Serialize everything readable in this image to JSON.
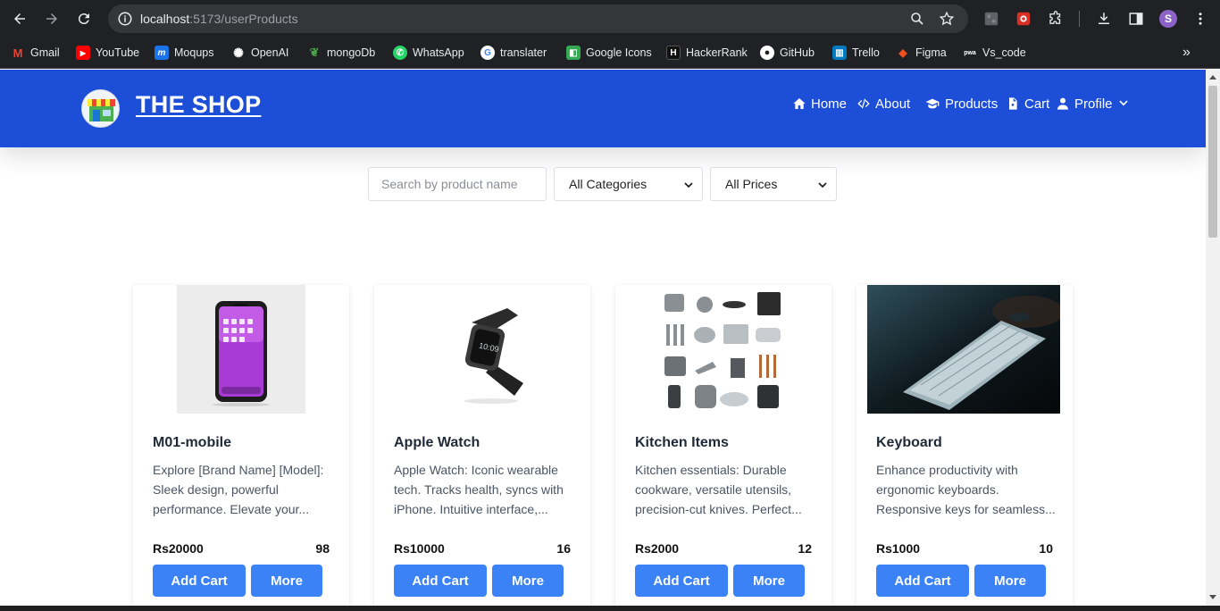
{
  "browser": {
    "url_host": "localhost",
    "url_path": ":5173/userProducts",
    "avatar_letter": "S",
    "bookmarks": [
      {
        "label": "Gmail",
        "icon": "gmail-icon",
        "color": "#ea4335",
        "glyph": "M"
      },
      {
        "label": "YouTube",
        "icon": "youtube-icon",
        "color": "#ff0000",
        "glyph": "▶"
      },
      {
        "label": "Moqups",
        "icon": "moqups-icon",
        "color": "#1a73e8",
        "glyph": "m"
      },
      {
        "label": "OpenAI",
        "icon": "openai-icon",
        "color": "#202124",
        "glyph": "✺"
      },
      {
        "label": "mongoDb",
        "icon": "mongodb-icon",
        "color": "#0b3d2e",
        "glyph": "❦"
      },
      {
        "label": "WhatsApp",
        "icon": "whatsapp-icon",
        "color": "#25d366",
        "glyph": "✆"
      },
      {
        "label": "translater",
        "icon": "google-icon",
        "color": "#ffffff",
        "glyph": "G"
      },
      {
        "label": "Google Icons",
        "icon": "google-icons-icon",
        "color": "#34a853",
        "glyph": "◧"
      },
      {
        "label": "HackerRank",
        "icon": "hackerrank-icon",
        "color": "#111111",
        "glyph": "H"
      },
      {
        "label": "GitHub",
        "icon": "github-icon",
        "color": "#202124",
        "glyph": "●"
      },
      {
        "label": "Trello",
        "icon": "trello-icon",
        "color": "#0079bf",
        "glyph": "▥"
      },
      {
        "label": "Figma",
        "icon": "figma-icon",
        "color": "#f24e1e",
        "glyph": "◆"
      },
      {
        "label": "Vs_code",
        "icon": "pwa-icon",
        "color": "#3c4043",
        "glyph": "pwa"
      }
    ]
  },
  "header": {
    "brand": "THE SHOP",
    "nav": [
      {
        "label": "Home",
        "icon": "home-icon"
      },
      {
        "label": "About",
        "icon": "code-icon"
      },
      {
        "label": "Products",
        "icon": "graduation-cap-icon"
      },
      {
        "label": "Cart",
        "icon": "file-icon"
      },
      {
        "label": "Profile",
        "icon": "user-icon"
      }
    ]
  },
  "filters": {
    "search_placeholder": "Search by product name",
    "category_selected": "All Categories",
    "price_selected": "All Prices"
  },
  "products": [
    {
      "title": "M01-mobile",
      "description": "Explore [Brand Name] [Model]: Sleek design, powerful performance. Elevate your...",
      "price": "Rs20000",
      "quantity": "98",
      "add_label": "Add Cart",
      "more_label": "More"
    },
    {
      "title": "Apple Watch",
      "description": "Apple Watch: Iconic wearable tech. Tracks health, syncs with iPhone. Intuitive interface,...",
      "price": "Rs10000",
      "quantity": "16",
      "add_label": "Add Cart",
      "more_label": "More"
    },
    {
      "title": "Kitchen Items",
      "description": "Kitchen essentials: Durable cookware, versatile utensils, precision-cut knives. Perfect...",
      "price": "Rs2000",
      "quantity": "12",
      "add_label": "Add Cart",
      "more_label": "More"
    },
    {
      "title": "Keyboard",
      "description": "Enhance productivity with ergonomic keyboards. Responsive keys for seamless...",
      "price": "Rs1000",
      "quantity": "10",
      "add_label": "Add Cart",
      "more_label": "More"
    }
  ],
  "colors": {
    "header_bg": "#1d4ed8",
    "button_bg": "#3b82f6",
    "chrome_bg": "#202124"
  }
}
